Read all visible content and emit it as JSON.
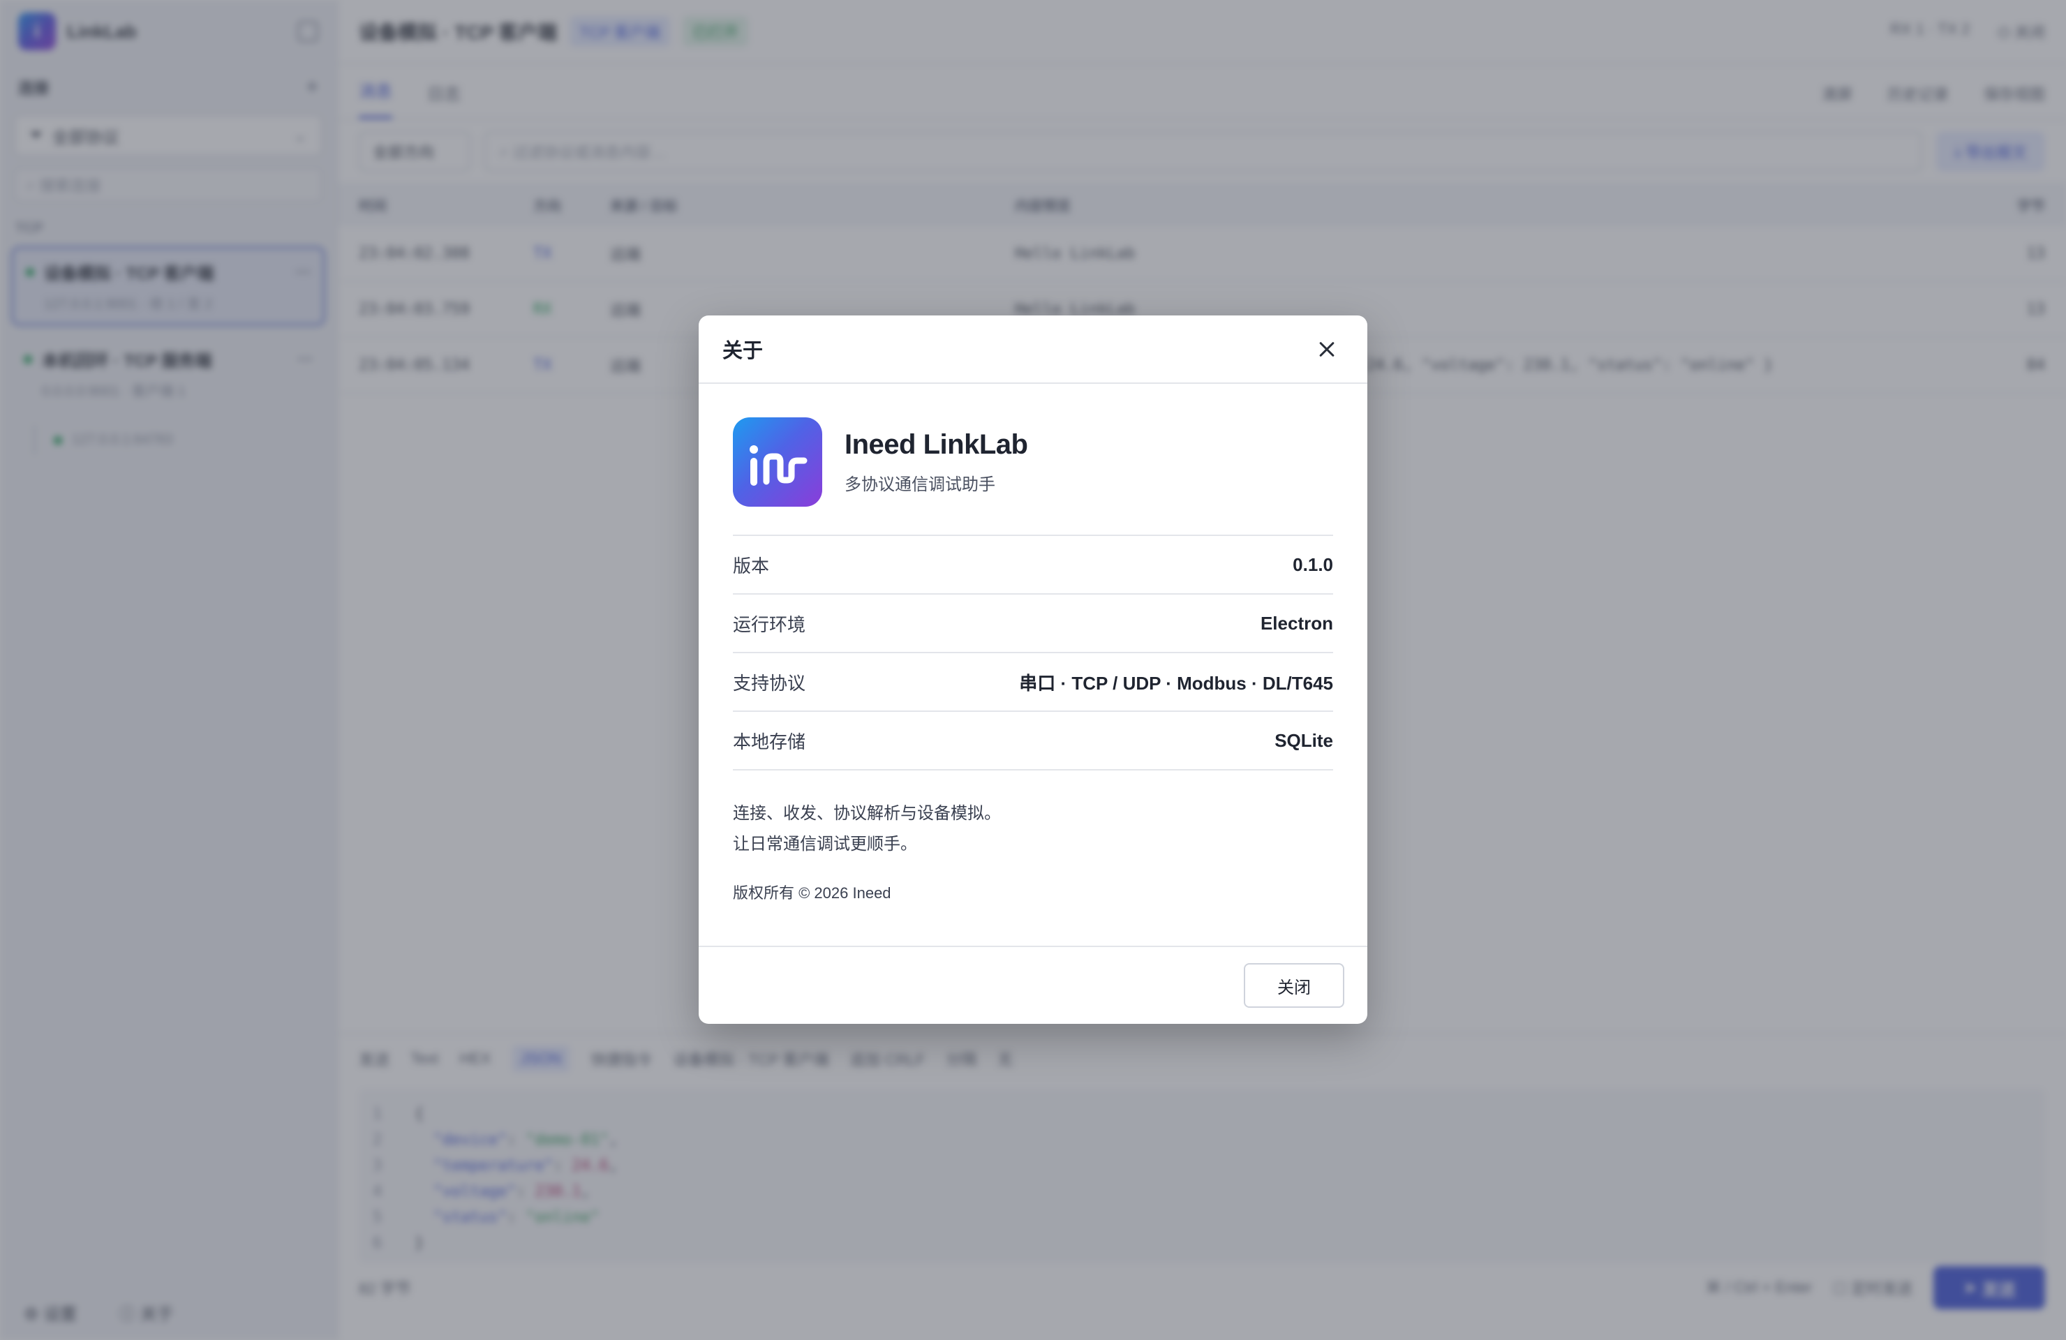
{
  "background": {
    "app_name": "LinkLab",
    "sidebar": {
      "section_label": "连接",
      "filter_label": "全部协议",
      "search_placeholder": "搜索连接",
      "group_label": "TCP",
      "connections": [
        {
          "name": "设备模拟 · TCP 客户端",
          "detail": "127.0.0.1:9001 · 收 1 / 发 2"
        },
        {
          "name": "本机回环 · TCP 服务端",
          "detail": "0.0.0.0:9001 · 客户端 1"
        }
      ],
      "sub_connection": "127.0.0.1:64783",
      "footer": {
        "settings": "设置",
        "about": "关于"
      }
    },
    "topbar": {
      "title": "设备模拟 · TCP 客户端",
      "tag_type": "TCP 客户端",
      "tag_status": "已打开",
      "stats": "RX 1 · TX 2",
      "close_label": "关闭"
    },
    "tabs": {
      "items": [
        "消息",
        "日志"
      ],
      "tools": [
        "清屏",
        "历史记录",
        "保存视图"
      ]
    },
    "filterbar": {
      "direction": "全部方向",
      "search_placeholder": "过滤协议或消息内容…",
      "export_label": "导出报文"
    },
    "table": {
      "columns": [
        "时间",
        "方向",
        "来源 / 目标",
        "内容预览",
        "字节"
      ],
      "rows": [
        {
          "time": "23:04:02.308",
          "dir": "TX",
          "peer": "远端",
          "data": "Hello LinkLab",
          "len": "13"
        },
        {
          "time": "23:04:03.759",
          "dir": "RX",
          "peer": "远端",
          "data": "Hello LinkLab",
          "len": "13"
        },
        {
          "time": "23:04:05.134",
          "dir": "TX",
          "peer": "远端",
          "data": "{ \"device\": \"demo-01\", \"temperature\": 24.6, \"voltage\": 230.1, \"status\": \"online\" }",
          "len": "84"
        }
      ]
    },
    "composer": {
      "label": "发送",
      "formats": [
        "Text",
        "HEX",
        "JSON",
        "快捷指令"
      ],
      "target": "设备模拟 · TCP 客户端",
      "suffix": "追加 CRLF",
      "interval_label": "分隔",
      "interval_value": "无",
      "code": [
        {
          "ln": "1",
          "text": "{"
        },
        {
          "ln": "2",
          "key": "\"device\"",
          "val": "\"demo-01\"",
          "type": "s"
        },
        {
          "ln": "3",
          "key": "\"temperature\"",
          "val": "24.6",
          "type": "n"
        },
        {
          "ln": "4",
          "key": "\"voltage\"",
          "val": "230.1",
          "type": "n"
        },
        {
          "ln": "5",
          "key": "\"status\"",
          "val": "\"online\"",
          "type": "s"
        },
        {
          "ln": "6",
          "text": "}"
        }
      ],
      "byte_count": "82 字节",
      "shortcut": "⌘ / Ctrl + Enter",
      "auto_send": "定时发送",
      "send_label": "发送"
    }
  },
  "dialog": {
    "title": "关于",
    "app_name": "Ineed LinkLab",
    "subtitle": "多协议通信调试助手",
    "info": [
      {
        "key": "版本",
        "value": "0.1.0"
      },
      {
        "key": "运行环境",
        "value": "Electron"
      },
      {
        "key": "支持协议",
        "value": "串口 · TCP / UDP · Modbus · DL/T645"
      },
      {
        "key": "本地存储",
        "value": "SQLite"
      }
    ],
    "description_line1": "连接、收发、协议解析与设备模拟。",
    "description_line2": "让日常通信调试更顺手。",
    "copyright": "版权所有 © 2026 Ineed",
    "close_button": "关闭"
  },
  "colors": {
    "accent": "#3f54d6",
    "logo_gradient_start": "#1e9bf0",
    "logo_gradient_end": "#8a3dd9",
    "status_green": "#22a35a",
    "overlay": "rgba(70,74,86,0.48)"
  }
}
